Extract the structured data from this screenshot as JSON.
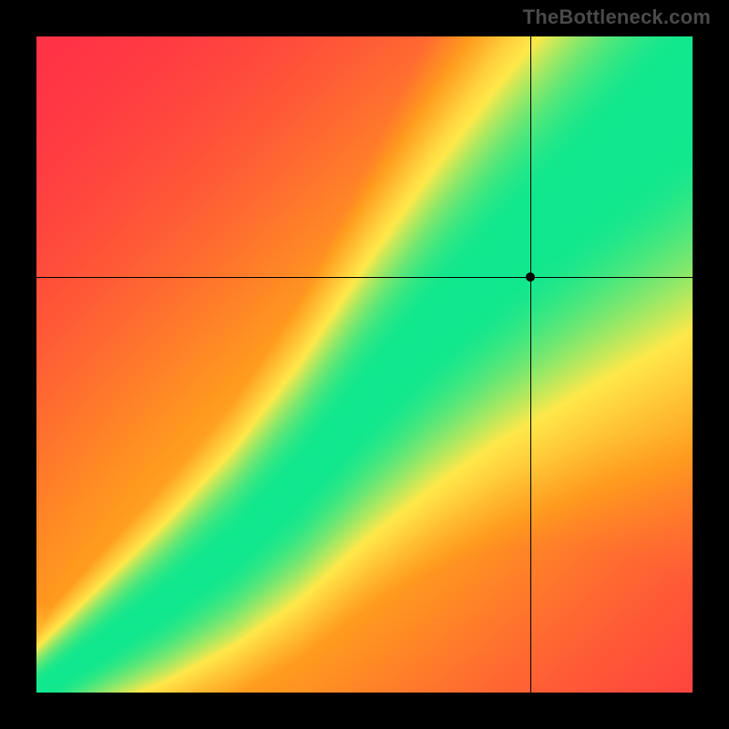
{
  "brand": "TheBottleneck.com",
  "chart_data": {
    "type": "heatmap",
    "title": "",
    "xlabel": "",
    "ylabel": "",
    "xlim": [
      0,
      100
    ],
    "ylim": [
      0,
      100
    ],
    "colorscale": [
      {
        "stop": 0.0,
        "hex": "#ff2b49"
      },
      {
        "stop": 0.45,
        "hex": "#ff9a1f"
      },
      {
        "stop": 0.75,
        "hex": "#ffe94a"
      },
      {
        "stop": 1.0,
        "hex": "#11e78e"
      }
    ],
    "field": {
      "description": "value at (x,y) in [0,1], 1 along the green ridge, falling off toward red away from it",
      "ridge": {
        "points_xy": [
          [
            0,
            0
          ],
          [
            10,
            7
          ],
          [
            20,
            14
          ],
          [
            30,
            22
          ],
          [
            40,
            32
          ],
          [
            50,
            44
          ],
          [
            60,
            55
          ],
          [
            70,
            65
          ],
          [
            80,
            74
          ],
          [
            90,
            83
          ],
          [
            100,
            92
          ]
        ],
        "halfwidth_at_x": [
          [
            0,
            1.5
          ],
          [
            15,
            2.5
          ],
          [
            30,
            3.5
          ],
          [
            50,
            5.5
          ],
          [
            70,
            8.0
          ],
          [
            85,
            10.0
          ],
          [
            100,
            13.0
          ]
        ]
      },
      "bottom_left_corner_value": 0.78,
      "top_left_corner_value": 0.0,
      "bottom_right_corner_value": 0.0,
      "top_right_corner_value": 1.0
    },
    "crosshair": {
      "x": 75.3,
      "y": 63.3
    },
    "marker": {
      "x": 75.3,
      "y": 63.3
    }
  }
}
